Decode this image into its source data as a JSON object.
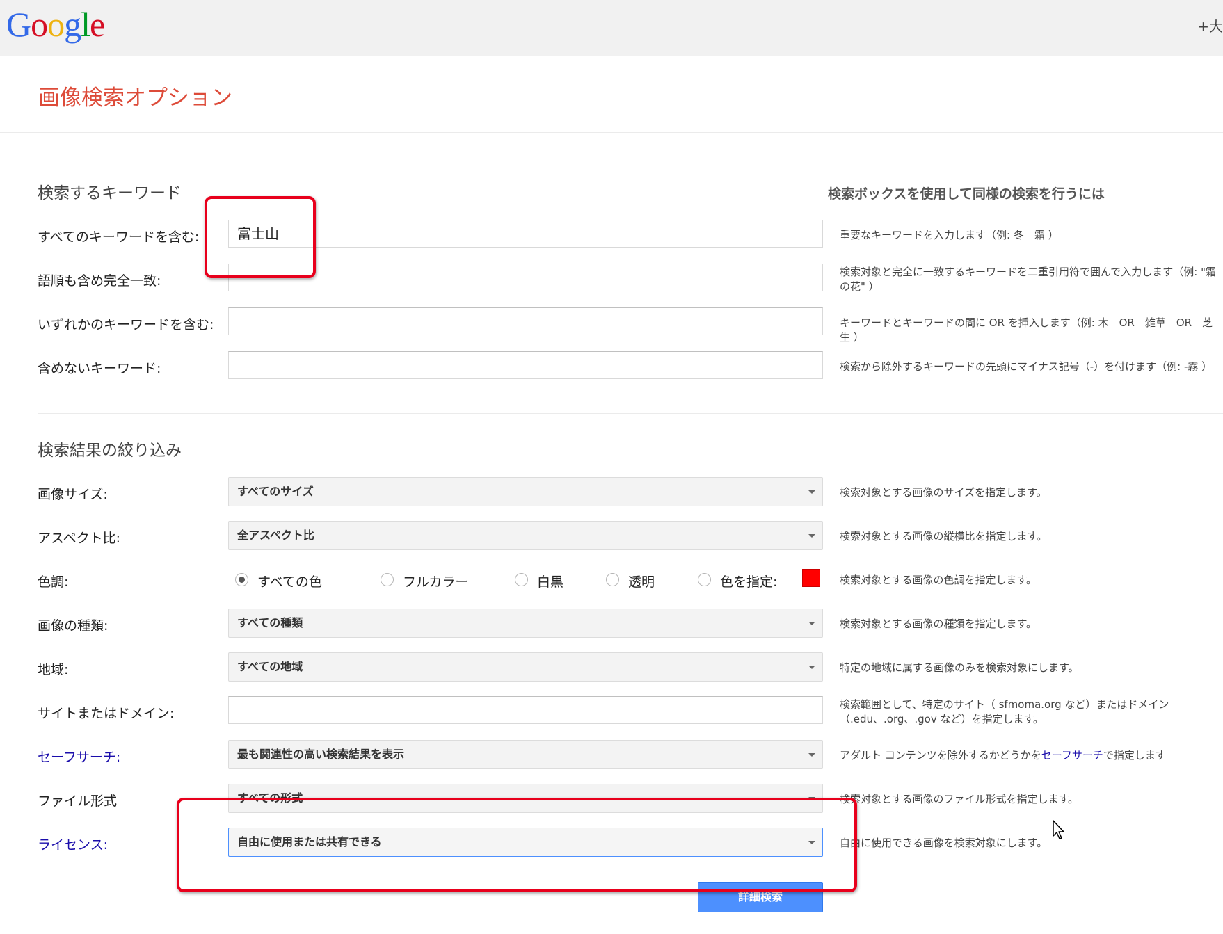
{
  "header": {
    "logo_letters": [
      {
        "char": "G",
        "color": "#3369e8"
      },
      {
        "char": "o",
        "color": "#d50f25"
      },
      {
        "char": "o",
        "color": "#eeb211"
      },
      {
        "char": "g",
        "color": "#3369e8"
      },
      {
        "char": "l",
        "color": "#009925"
      },
      {
        "char": "e",
        "color": "#d50f25"
      }
    ],
    "right_link": "+大"
  },
  "page_title": "画像検索オプション",
  "keywords_section": {
    "title": "検索するキーワード",
    "help_heading": "検索ボックスを使用して同様の検索を行うには",
    "rows": [
      {
        "label": "すべてのキーワードを含む:",
        "value": "富士山",
        "help": "重要なキーワードを入力します（例: 冬　霜 ）"
      },
      {
        "label": "語順も含め完全一致:",
        "value": "",
        "help": "検索対象と完全に一致するキーワードを二重引用符で囲んで入力します（例: \"霜の花\" ）"
      },
      {
        "label": "いずれかのキーワードを含む:",
        "value": "",
        "help": "キーワードとキーワードの間に OR を挿入します（例: 木　OR　雑草　OR　芝生 ）"
      },
      {
        "label": "含めないキーワード:",
        "value": "",
        "help": "検索から除外するキーワードの先頭にマイナス記号（-）を付けます（例: -霧 ）"
      }
    ]
  },
  "filter_section": {
    "title": "検索結果の絞り込み",
    "image_size": {
      "label": "画像サイズ:",
      "selected": "すべてのサイズ",
      "help": "検索対象とする画像のサイズを指定します。"
    },
    "aspect_ratio": {
      "label": "アスペクト比:",
      "selected": "全アスペクト比",
      "help": "検索対象とする画像の縦横比を指定します。"
    },
    "color": {
      "label": "色調:",
      "options": [
        "すべての色",
        "フルカラー",
        "白黒",
        "透明",
        "色を指定:"
      ],
      "selected_index": 0,
      "swatch_color": "#ff0000",
      "help": "検索対象とする画像の色調を指定します。"
    },
    "image_type": {
      "label": "画像の種類:",
      "selected": "すべての種類",
      "help": "検索対象とする画像の種類を指定します。"
    },
    "region": {
      "label": "地域:",
      "selected": "すべての地域",
      "help": "特定の地域に属する画像のみを検索対象にします。"
    },
    "site": {
      "label": "サイトまたはドメイン:",
      "value": "",
      "help": "検索範囲として、特定のサイト（ sfmoma.org など）またはドメイン（.edu、.org、.gov など）を指定します。"
    },
    "safesearch": {
      "label": "セーフサーチ:",
      "selected": "最も関連性の高い検索結果を表示",
      "help_before": "アダルト コンテンツを除外するかどうかを",
      "help_link": "セーフサーチ",
      "help_after": "で指定します"
    },
    "file_type": {
      "label": "ファイル形式",
      "selected": "すべての形式",
      "help": "検索対象とする画像のファイル形式を指定します。"
    },
    "license": {
      "label": "ライセンス:",
      "selected": "自由に使用または共有できる",
      "help": "自由に使用できる画像を検索対象にします。"
    }
  },
  "submit_label": "詳細検索"
}
